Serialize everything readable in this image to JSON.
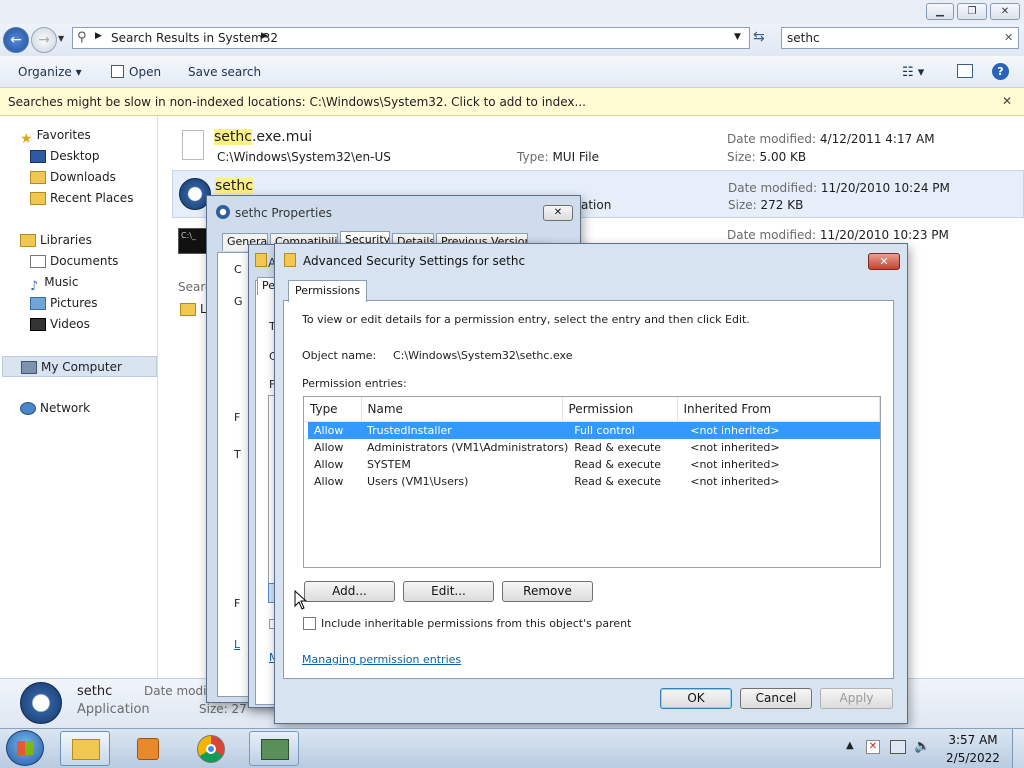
{
  "window": {
    "caption_buttons": [
      "minimize",
      "restore",
      "close"
    ]
  },
  "nav": {
    "breadcrumb": "Search Results in System32",
    "search_value": "sethc"
  },
  "toolbar": {
    "organize": "Organize",
    "open": "Open",
    "save_search": "Save search"
  },
  "infobar": {
    "text": "Searches might be slow in non-indexed locations: C:\\Windows\\System32. Click to add to index..."
  },
  "sidebar": {
    "favorites": "Favorites",
    "fav_items": [
      "Desktop",
      "Downloads",
      "Recent Places"
    ],
    "libraries": "Libraries",
    "lib_items": [
      "Documents",
      "Music",
      "Pictures",
      "Videos"
    ],
    "computer": "My Computer",
    "network": "Network"
  },
  "results": [
    {
      "name_hl": "sethc",
      "name_rest": ".exe.mui",
      "path": "C:\\Windows\\System32\\en-US",
      "type_label": "Type:",
      "type": "MUI File",
      "date_label": "Date modified:",
      "date": "4/12/2011 4:17 AM",
      "size_label": "Size:",
      "size": "5.00 KB"
    },
    {
      "name_hl": "sethc",
      "name_rest": "",
      "type_partial": "ation",
      "date_label": "Date modified:",
      "date": "11/20/2010 10:24 PM",
      "size_label": "Size:",
      "size": "272 KB"
    },
    {
      "date_label": "Date modified:",
      "date": "11/20/2010 10:23 PM"
    }
  ],
  "partial": {
    "search_again": "Searc",
    "lib_letter": "L"
  },
  "details": {
    "name": "sethc",
    "type": "Application",
    "date_label": "Date modifi",
    "size_label": "Size: 27"
  },
  "props": {
    "title": "sethc Properties",
    "tabs": [
      "General",
      "Compatibility",
      "Security",
      "Details",
      "Previous Versions"
    ],
    "inner_tab": "Pe",
    "stub_letters": [
      "C",
      "G",
      "T",
      "C",
      "F",
      "T",
      "F",
      "F"
    ],
    "stub_link": "L",
    "stub_link2": "M"
  },
  "adv": {
    "title": "Advanced Security Settings for sethc",
    "tab": "Permissions",
    "intro": "To view or edit details for a permission entry, select the entry and then click Edit.",
    "object_label": "Object name:",
    "object_value": "C:\\Windows\\System32\\sethc.exe",
    "entries_label": "Permission entries:",
    "columns": [
      "Type",
      "Name",
      "Permission",
      "Inherited From"
    ],
    "rows": [
      [
        "Allow",
        "TrustedInstaller",
        "Full control",
        "<not inherited>"
      ],
      [
        "Allow",
        "Administrators (VM1\\Administrators)",
        "Read & execute",
        "<not inherited>"
      ],
      [
        "Allow",
        "SYSTEM",
        "Read & execute",
        "<not inherited>"
      ],
      [
        "Allow",
        "Users (VM1\\Users)",
        "Read & execute",
        "<not inherited>"
      ]
    ],
    "add": "Add...",
    "edit": "Edit...",
    "remove": "Remove",
    "checkbox": "Include inheritable permissions from this object's parent",
    "link": "Managing permission entries",
    "ok": "OK",
    "cancel": "Cancel",
    "apply": "Apply"
  },
  "taskbar": {
    "time": "3:57 AM",
    "date": "2/5/2022"
  }
}
